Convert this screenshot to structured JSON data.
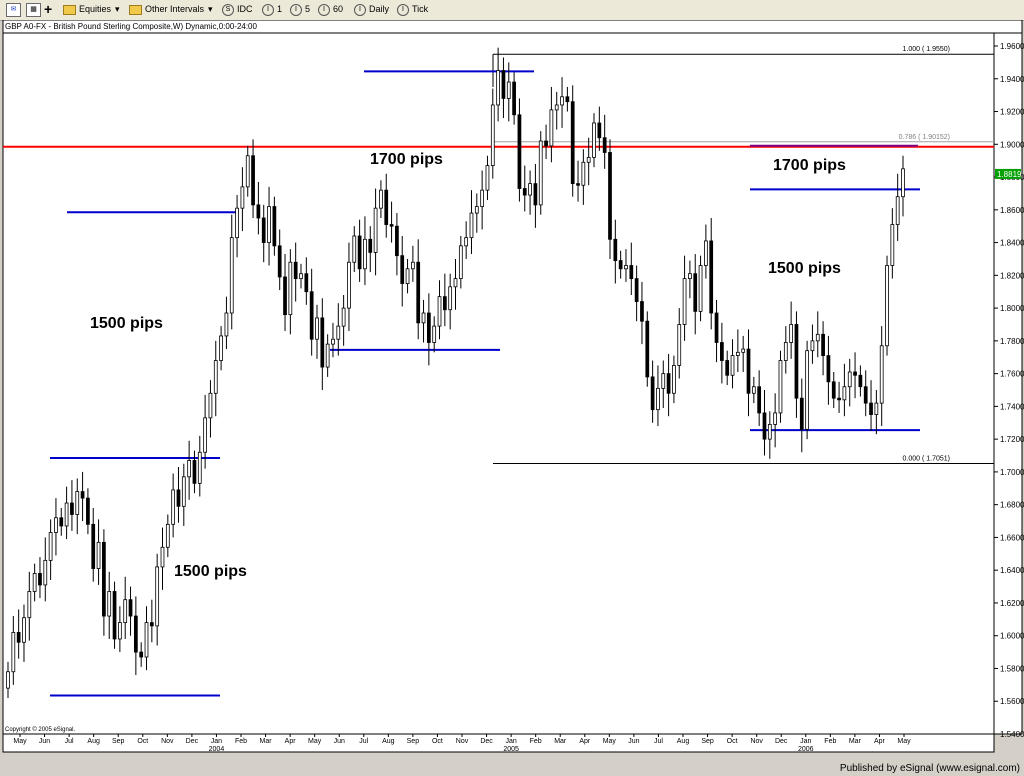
{
  "toolbar": {
    "symbol_menu": "Equities",
    "interval_menu": "Other Intervals",
    "buttons": [
      "IDC",
      "1",
      "5",
      "60",
      "Daily",
      "Tick"
    ],
    "button_icons": [
      "S",
      "I",
      "I",
      "I",
      "I",
      "I"
    ]
  },
  "footer": {
    "published": "Published by eSignal (www.esignal.com)"
  },
  "chart_data": {
    "type": "candlestick",
    "title": "GBP A0-FX - British Pound Sterling Composite,W) Dynamic,0:00-24:00",
    "copyright": "Copyright © 2005 eSignal.",
    "ylim": [
      1.54,
      1.965
    ],
    "ytick_labels": [
      "1.9600",
      "1.9400",
      "1.9200",
      "1.9000",
      "1.8800",
      "1.8600",
      "1.8400",
      "1.8200",
      "1.8000",
      "1.7800",
      "1.7600",
      "1.7400",
      "1.7200",
      "1.7000",
      "1.6800",
      "1.6600",
      "1.6400",
      "1.6200",
      "1.6000",
      "1.5800",
      "1.5600",
      "1.5400"
    ],
    "xtick_labels": [
      "May",
      "Jun",
      "Jul",
      "Aug",
      "Sep",
      "Oct",
      "Nov",
      "Dec",
      "Jan",
      "Feb",
      "Mar",
      "Apr",
      "May",
      "Jun",
      "Jul",
      "Aug",
      "Sep",
      "Oct",
      "Nov",
      "Dec",
      "Jan",
      "Feb",
      "Mar",
      "Apr",
      "May",
      "Jun",
      "Jul",
      "Aug",
      "Sep",
      "Oct",
      "Nov",
      "Dec",
      "Jan",
      "Feb",
      "Mar",
      "Apr",
      "May"
    ],
    "year_labels": [
      {
        "text": "2004",
        "at": "Jan"
      },
      {
        "text": "2005",
        "at": "Jan"
      },
      {
        "text": "2006",
        "at": "Jan"
      }
    ],
    "last_price": "1.8819",
    "fib_levels": [
      {
        "label": "1.000 ( 1.9550)",
        "value": 1.955
      },
      {
        "label": "0.786 ( 1.90152)",
        "value": 1.90152
      },
      {
        "label": "0.000 ( 1.7051)",
        "value": 1.7051
      }
    ],
    "resistance_line": 1.8985,
    "annotations": [
      {
        "text": "1500 pips"
      },
      {
        "text": "1500 pips"
      },
      {
        "text": "1700 pips"
      },
      {
        "text": "1700 pips"
      },
      {
        "text": "1500 pips"
      }
    ],
    "blue_levels": [
      1.5635,
      1.7085,
      1.8585,
      1.7745,
      1.9445,
      1.8725,
      1.7255
    ],
    "candles_weekly_close": [
      1.578,
      1.602,
      1.596,
      1.611,
      1.627,
      1.638,
      1.631,
      1.646,
      1.663,
      1.672,
      1.667,
      1.681,
      1.674,
      1.688,
      1.684,
      1.668,
      1.641,
      1.657,
      1.612,
      1.627,
      1.598,
      1.608,
      1.622,
      1.612,
      1.59,
      1.587,
      1.608,
      1.606,
      1.642,
      1.654,
      1.668,
      1.689,
      1.679,
      1.697,
      1.707,
      1.693,
      1.712,
      1.733,
      1.748,
      1.768,
      1.783,
      1.797,
      1.843,
      1.861,
      1.874,
      1.893,
      1.863,
      1.855,
      1.84,
      1.862,
      1.838,
      1.819,
      1.796,
      1.828,
      1.818,
      1.821,
      1.81,
      1.781,
      1.794,
      1.764,
      1.778,
      1.781,
      1.789,
      1.8,
      1.828,
      1.844,
      1.824,
      1.842,
      1.834,
      1.861,
      1.872,
      1.851,
      1.85,
      1.832,
      1.815,
      1.824,
      1.828,
      1.791,
      1.797,
      1.779,
      1.789,
      1.807,
      1.799,
      1.813,
      1.818,
      1.838,
      1.843,
      1.858,
      1.862,
      1.872,
      1.887,
      1.924,
      1.945,
      1.928,
      1.938,
      1.918,
      1.873,
      1.869,
      1.876,
      1.863,
      1.902,
      1.899,
      1.921,
      1.924,
      1.929,
      1.926,
      1.876,
      1.875,
      1.889,
      1.892,
      1.913,
      1.904,
      1.895,
      1.842,
      1.829,
      1.824,
      1.826,
      1.818,
      1.804,
      1.792,
      1.758,
      1.738,
      1.751,
      1.76,
      1.748,
      1.765,
      1.79,
      1.818,
      1.821,
      1.798,
      1.826,
      1.841,
      1.797,
      1.779,
      1.768,
      1.759,
      1.771,
      1.773,
      1.775,
      1.748,
      1.752,
      1.736,
      1.72,
      1.729,
      1.736,
      1.768,
      1.779,
      1.79,
      1.745,
      1.726,
      1.774,
      1.78,
      1.784,
      1.771,
      1.755,
      1.745,
      1.744,
      1.752,
      1.761,
      1.759,
      1.752,
      1.742,
      1.735,
      1.742,
      1.777,
      1.826,
      1.851,
      1.868,
      1.885
    ]
  }
}
